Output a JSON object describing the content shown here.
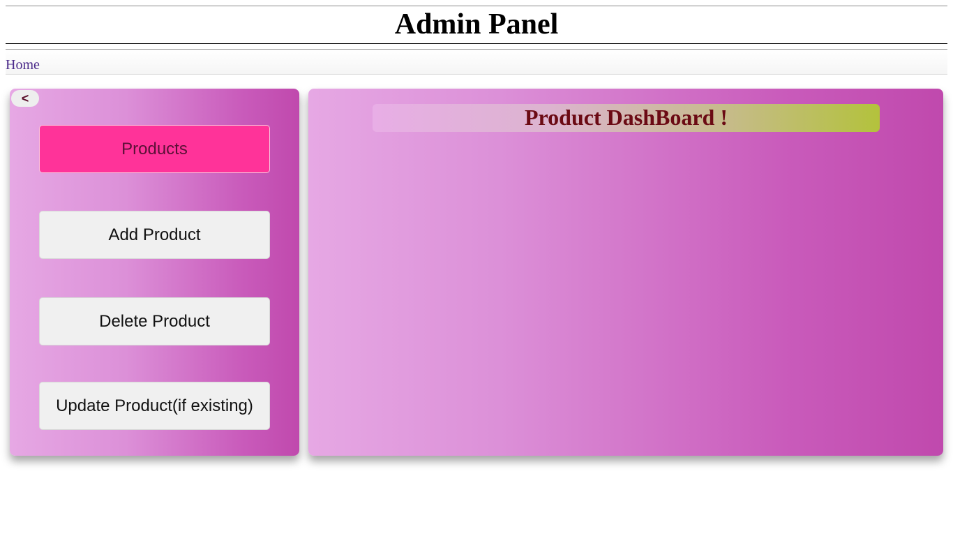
{
  "header": {
    "title": "Admin Panel"
  },
  "breadcrumb": {
    "home_label": "Home"
  },
  "sidebar": {
    "collapse_label": "<",
    "items": [
      {
        "label": "Products",
        "active": true
      },
      {
        "label": "Add Product",
        "active": false
      },
      {
        "label": "Delete Product",
        "active": false
      },
      {
        "label": "Update Product(if existing)",
        "active": false
      }
    ]
  },
  "main": {
    "title": "Product DashBoard !"
  },
  "colors": {
    "active_button": "#ff3399",
    "panel_gradient_start": "#e6a8e4",
    "panel_gradient_end": "#c049ad",
    "title_text": "#6b0a14"
  }
}
